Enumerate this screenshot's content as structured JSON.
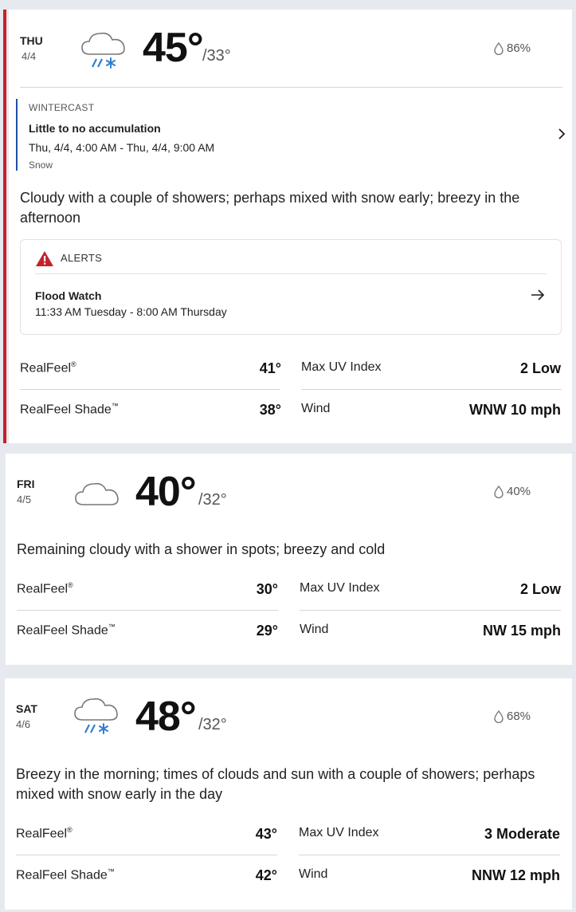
{
  "days": [
    {
      "name": "THU",
      "date": "4/4",
      "icon": "cloud-rain-snow-icon",
      "high": "45°",
      "low": "/33°",
      "precip": "86%",
      "wintercast": {
        "title": "WINTERCAST",
        "headline": "Little to no accumulation",
        "time": "Thu, 4/4, 4:00 AM - Thu, 4/4, 9:00 AM",
        "type": "Snow"
      },
      "phrase": "Cloudy with a couple of showers; perhaps mixed with snow early; breezy in the afternoon",
      "alerts": {
        "title": "ALERTS",
        "name": "Flood Watch",
        "time": "11:33 AM Tuesday - 8:00 AM Thursday"
      },
      "stats": {
        "realfeel_label": "RealFeel",
        "realfeel": "41°",
        "shade_label": "RealFeel Shade",
        "shade": "38°",
        "uv_label": "Max UV Index",
        "uv": "2 Low",
        "wind_label": "Wind",
        "wind": "WNW 10 mph"
      }
    },
    {
      "name": "FRI",
      "date": "4/5",
      "icon": "cloud-icon",
      "high": "40°",
      "low": "/32°",
      "precip": "40%",
      "phrase": "Remaining cloudy with a shower in spots; breezy and cold",
      "stats": {
        "realfeel_label": "RealFeel",
        "realfeel": "30°",
        "shade_label": "RealFeel Shade",
        "shade": "29°",
        "uv_label": "Max UV Index",
        "uv": "2 Low",
        "wind_label": "Wind",
        "wind": "NW 15 mph"
      }
    },
    {
      "name": "SAT",
      "date": "4/6",
      "icon": "cloud-rain-snow-icon",
      "high": "48°",
      "low": "/32°",
      "precip": "68%",
      "phrase": "Breezy in the morning; times of clouds and sun with a couple of showers; perhaps mixed with snow early in the day",
      "stats": {
        "realfeel_label": "RealFeel",
        "realfeel": "43°",
        "shade_label": "RealFeel Shade",
        "shade": "42°",
        "uv_label": "Max UV Index",
        "uv": "3 Moderate",
        "wind_label": "Wind",
        "wind": "NNW 12 mph"
      }
    }
  ],
  "colors": {
    "accent_red": "#c8202a",
    "wintercast_blue": "#2050a8",
    "snow_blue": "#2f7fd0"
  }
}
